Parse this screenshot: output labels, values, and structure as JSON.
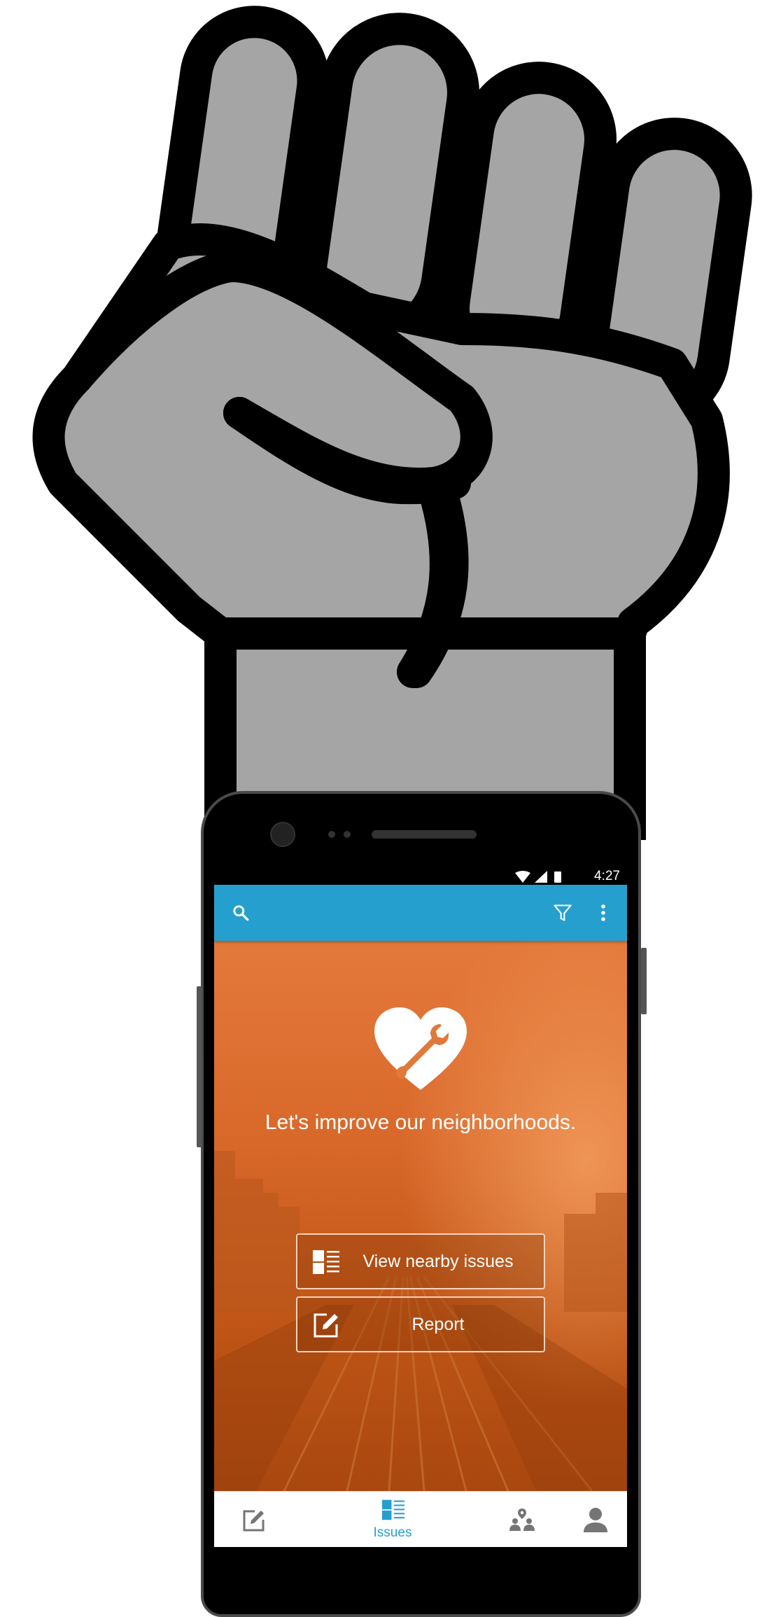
{
  "status_bar": {
    "time": "4:27"
  },
  "toolbar": {
    "search_icon": "search-icon",
    "filter_icon": "filter-icon",
    "more_icon": "more-vert-icon"
  },
  "hero": {
    "logo_icon": "heart-wrench-icon",
    "tagline": "Let's improve our neighborhoods.",
    "buttons": [
      {
        "label": "View nearby issues",
        "icon": "list-icon"
      },
      {
        "label": "Report",
        "icon": "edit-icon"
      }
    ]
  },
  "bottom_nav": {
    "items": [
      {
        "label": "",
        "icon": "edit-icon",
        "active": false
      },
      {
        "label": "Issues",
        "icon": "list-icon",
        "active": true
      },
      {
        "label": "",
        "icon": "people-location-icon",
        "active": false
      },
      {
        "label": "",
        "icon": "person-icon",
        "active": false
      }
    ]
  },
  "colors": {
    "app_bar": "#25a0ce",
    "hero_orange": "#e07a3a",
    "active_tab": "#25a0ce",
    "inactive_tab": "#757575"
  }
}
